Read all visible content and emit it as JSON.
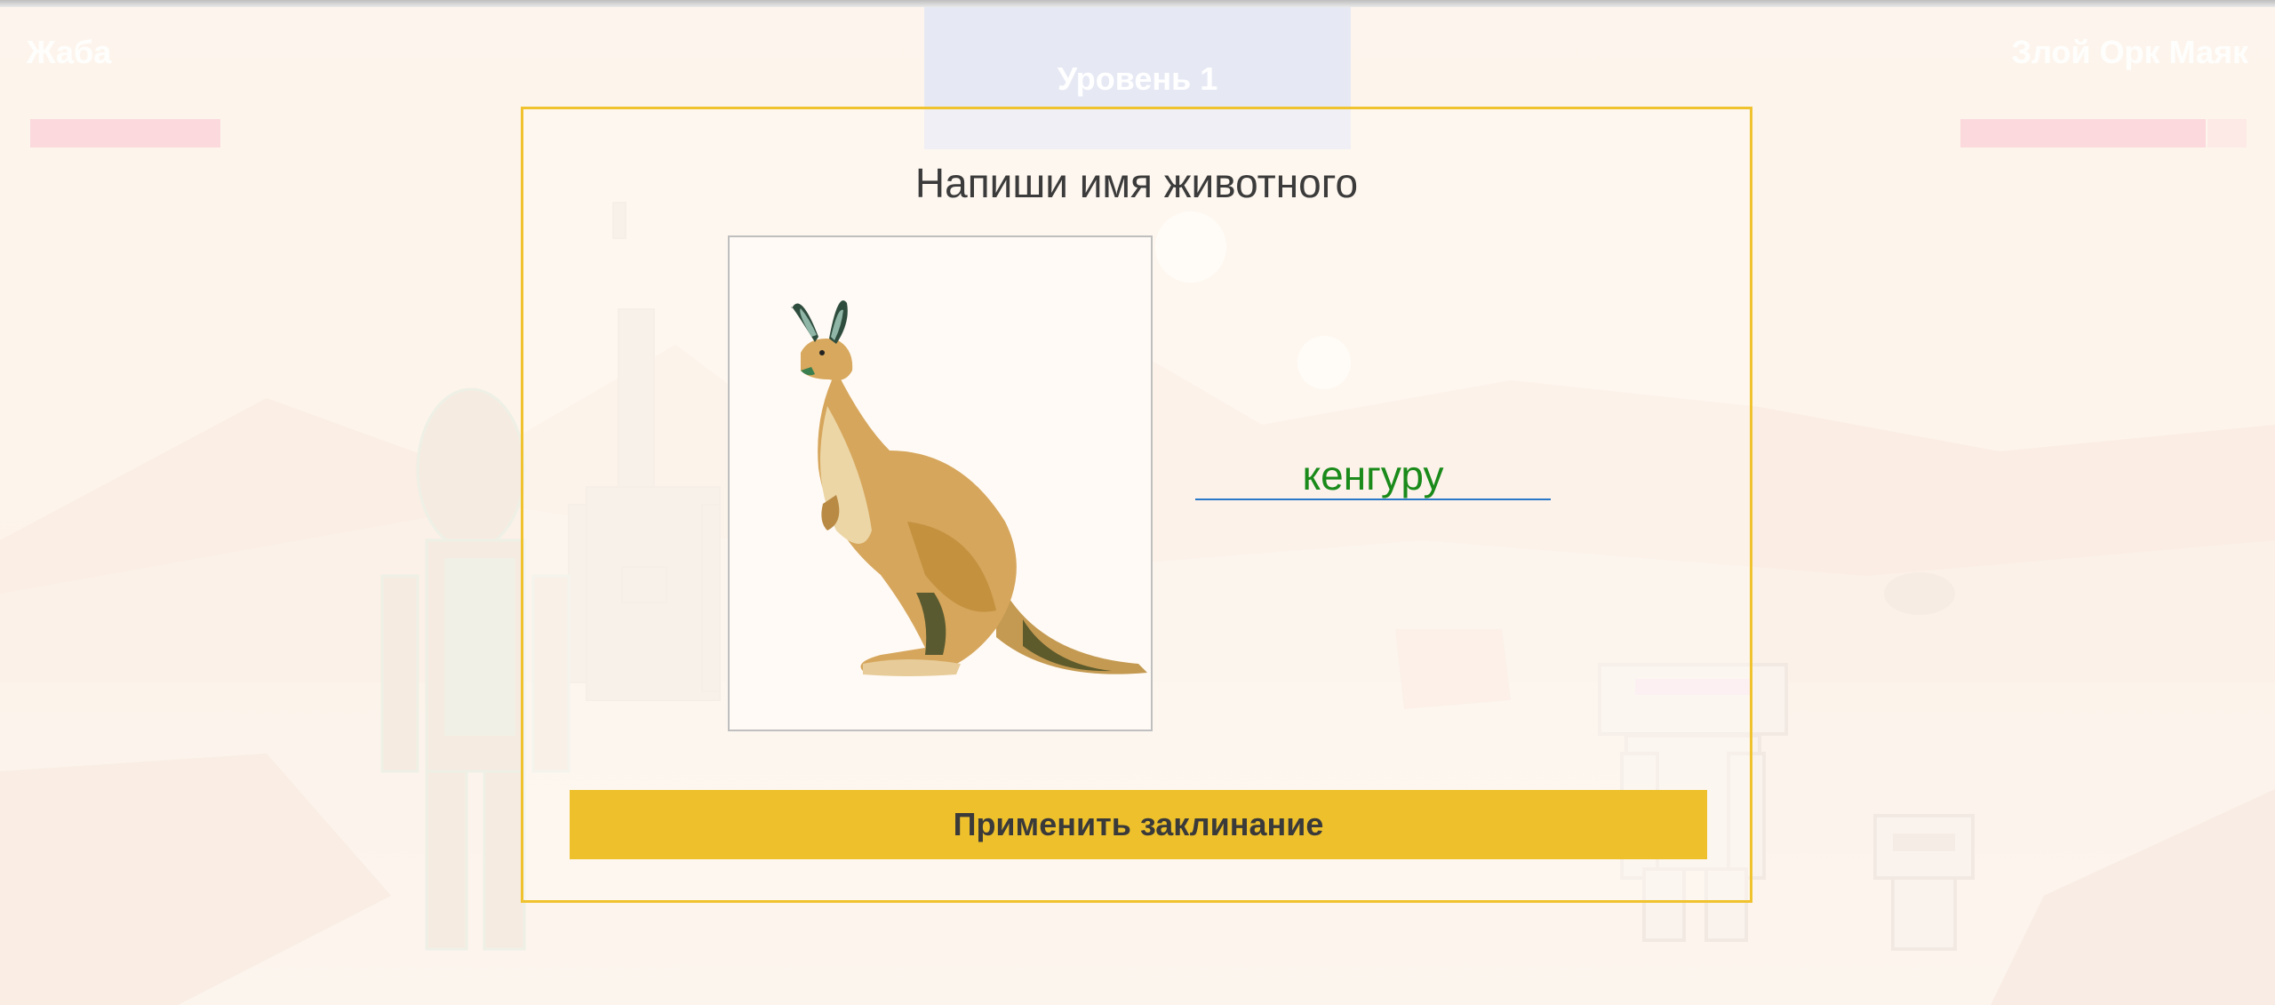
{
  "hud": {
    "left_player_name": "Жаба",
    "right_player_name": "Злой Орк Маяк",
    "level_label": "Уровень 1"
  },
  "modal": {
    "title": "Напиши имя животного",
    "picture_subject": "kangaroo",
    "answer_value": "кенгуру",
    "submit_label": "Применить заклинание"
  },
  "colors": {
    "accent_yellow": "#eec12c",
    "frame_yellow": "#f0c22e",
    "answer_green": "#1a8a1a",
    "underline_blue": "#2a78c8",
    "hp_pink": "#fbd9dd"
  }
}
